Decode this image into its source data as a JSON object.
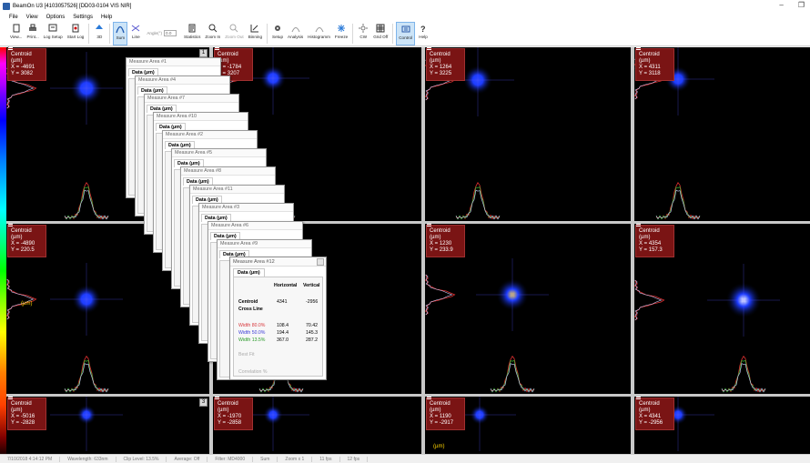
{
  "window": {
    "title": "BeamOn U3 [4103057526] [DD03-0104 VIS NIR]",
    "minimize": "–",
    "restore": "❐"
  },
  "menu": [
    "File",
    "View",
    "Options",
    "Settings",
    "Help"
  ],
  "toolbar": [
    {
      "id": "view",
      "label": "View...",
      "icon": "view-icon"
    },
    {
      "id": "print",
      "label": "Print...",
      "icon": "print-icon"
    },
    {
      "id": "log-setup",
      "label": "Log Setup",
      "icon": "log-setup-icon"
    },
    {
      "id": "start-log",
      "label": "Start Log",
      "icon": "start-log-icon"
    },
    {
      "id": "3d",
      "label": "3D",
      "icon": "3d-icon"
    },
    {
      "id": "sum",
      "label": "Sum",
      "icon": "sum-icon",
      "active": true
    },
    {
      "id": "line",
      "label": "Line",
      "icon": "line-icon"
    },
    {
      "id": "statistics",
      "label": "Statistics",
      "icon": "statistics-icon"
    },
    {
      "id": "zoom-in",
      "label": "Zoom In",
      "icon": "zoom-in-icon"
    },
    {
      "id": "zoom-out",
      "label": "Zoom Out",
      "icon": "zoom-out-icon",
      "dim": true
    },
    {
      "id": "binning",
      "label": "Binning",
      "icon": "binning-icon"
    },
    {
      "id": "setup",
      "label": "Setup",
      "icon": "setup-icon"
    },
    {
      "id": "analysis",
      "label": "Analysis",
      "icon": "analysis-icon"
    },
    {
      "id": "histogramm",
      "label": "Histogramm",
      "icon": "histogramm-icon"
    },
    {
      "id": "freeze",
      "label": "Freeze",
      "icon": "freeze-icon"
    },
    {
      "id": "cw",
      "label": "CW",
      "icon": "cw-icon"
    },
    {
      "id": "grid-off",
      "label": "Grid Off",
      "icon": "grid-off-icon"
    },
    {
      "id": "control",
      "label": "Control",
      "icon": "control-icon",
      "active": true
    },
    {
      "id": "help",
      "label": "Help",
      "icon": "help-icon"
    }
  ],
  "angle": {
    "label": "Angle(°)",
    "value": "0.0"
  },
  "panels": [
    {
      "idx": 0,
      "number": "1",
      "title": "Centroid (µm)",
      "x": "X = -4691",
      "y": "Y = 3082"
    },
    {
      "idx": 1,
      "number": "4",
      "title": "Centroid (µm)",
      "x": "X = -1784",
      "y": "Y = 3207"
    },
    {
      "idx": 2,
      "number": "4",
      "title": "Centroid (µm)",
      "x": "X = 1264",
      "y": "Y = 3225"
    },
    {
      "idx": 3,
      "number": "7",
      "title": "Centroid (µm)",
      "x": "X = 4311",
      "y": "Y = 3118"
    },
    {
      "idx": 4,
      "number": "2",
      "title": "Centroid (µm)",
      "x": "X = -4890",
      "y": "Y = 220.5"
    },
    {
      "idx": 5,
      "number": "5",
      "title": "Centroid (µm)",
      "x": "X = -1784",
      "y": "Y = 220.5"
    },
    {
      "idx": 6,
      "number": "5",
      "title": "Centroid (µm)",
      "x": "X = 1230",
      "y": "Y = 233.9"
    },
    {
      "idx": 7,
      "number": "8",
      "title": "Centroid (µm)",
      "x": "X = 4354",
      "y": "Y = 157.3"
    },
    {
      "idx": 8,
      "number": "3",
      "title": "Centroid (µm)",
      "x": "X = -5016",
      "y": "Y = -2828"
    },
    {
      "idx": 9,
      "number": "3",
      "title": "Centroid (µm)",
      "x": "X = -1970",
      "y": "Y = -2858"
    },
    {
      "idx": 10,
      "number": "6",
      "title": "Centroid (µm)",
      "x": "X = 1190",
      "y": "Y = -2917"
    },
    {
      "idx": 11,
      "number": "9",
      "title": "Centroid (µm)",
      "x": "X = 4341",
      "y": "Y = -2956"
    }
  ],
  "axis_label": "(µm)",
  "measure_windows": [
    {
      "title": "Measure Area #1",
      "tab": "Data (µm)"
    },
    {
      "title": "Measure Area #4",
      "tab": "Data (µm)"
    },
    {
      "title": "Measure Area #7",
      "tab": "Data (µm)"
    },
    {
      "title": "Measure Area #10",
      "tab": "Data (µm)"
    },
    {
      "title": "Measure Area #2",
      "tab": "Data (µm)"
    },
    {
      "title": "Measure Area #5",
      "tab": "Data (µm)"
    },
    {
      "title": "Measure Area #8",
      "tab": "Data (µm)"
    },
    {
      "title": "Measure Area #11",
      "tab": "Data (µm)"
    },
    {
      "title": "Measure Area #3",
      "tab": "Data (µm)"
    },
    {
      "title": "Measure Area #6",
      "tab": "Data (µm)"
    },
    {
      "title": "Measure Area #9",
      "tab": "Data (µm)"
    }
  ],
  "measure_front": {
    "title": "Measure Area #12",
    "tab": "Data (µm)",
    "col_h": "Horizontal",
    "col_v": "Vertical",
    "centroid_label": "Centroid",
    "centroid_h": "4341",
    "centroid_v": "-2956",
    "cross_label": "Cross Line",
    "w80_label": "Width 80.0%",
    "w80_h": "108.4",
    "w80_v": "70.42",
    "w50_label": "Width 50.0%",
    "w50_h": "194.4",
    "w50_v": "145.3",
    "w13_label": "Width 13.5%",
    "w13_h": "367.0",
    "w13_v": "287.2",
    "bestfit_label": "Best Fit",
    "correlation_label": "Correlation %",
    "colors": {
      "w80": "#d8383c",
      "w50": "#3b3bd8",
      "w13": "#2a9a2a"
    }
  },
  "statusbar": [
    "7/10/2018 4:14:12 PM",
    "Wavelength: 633nm",
    "Clip Level: 13.5%",
    "Average: Off",
    "Filter: MD4000",
    "Sum",
    "Zoom x 1",
    "11 fps",
    "12 fps"
  ]
}
